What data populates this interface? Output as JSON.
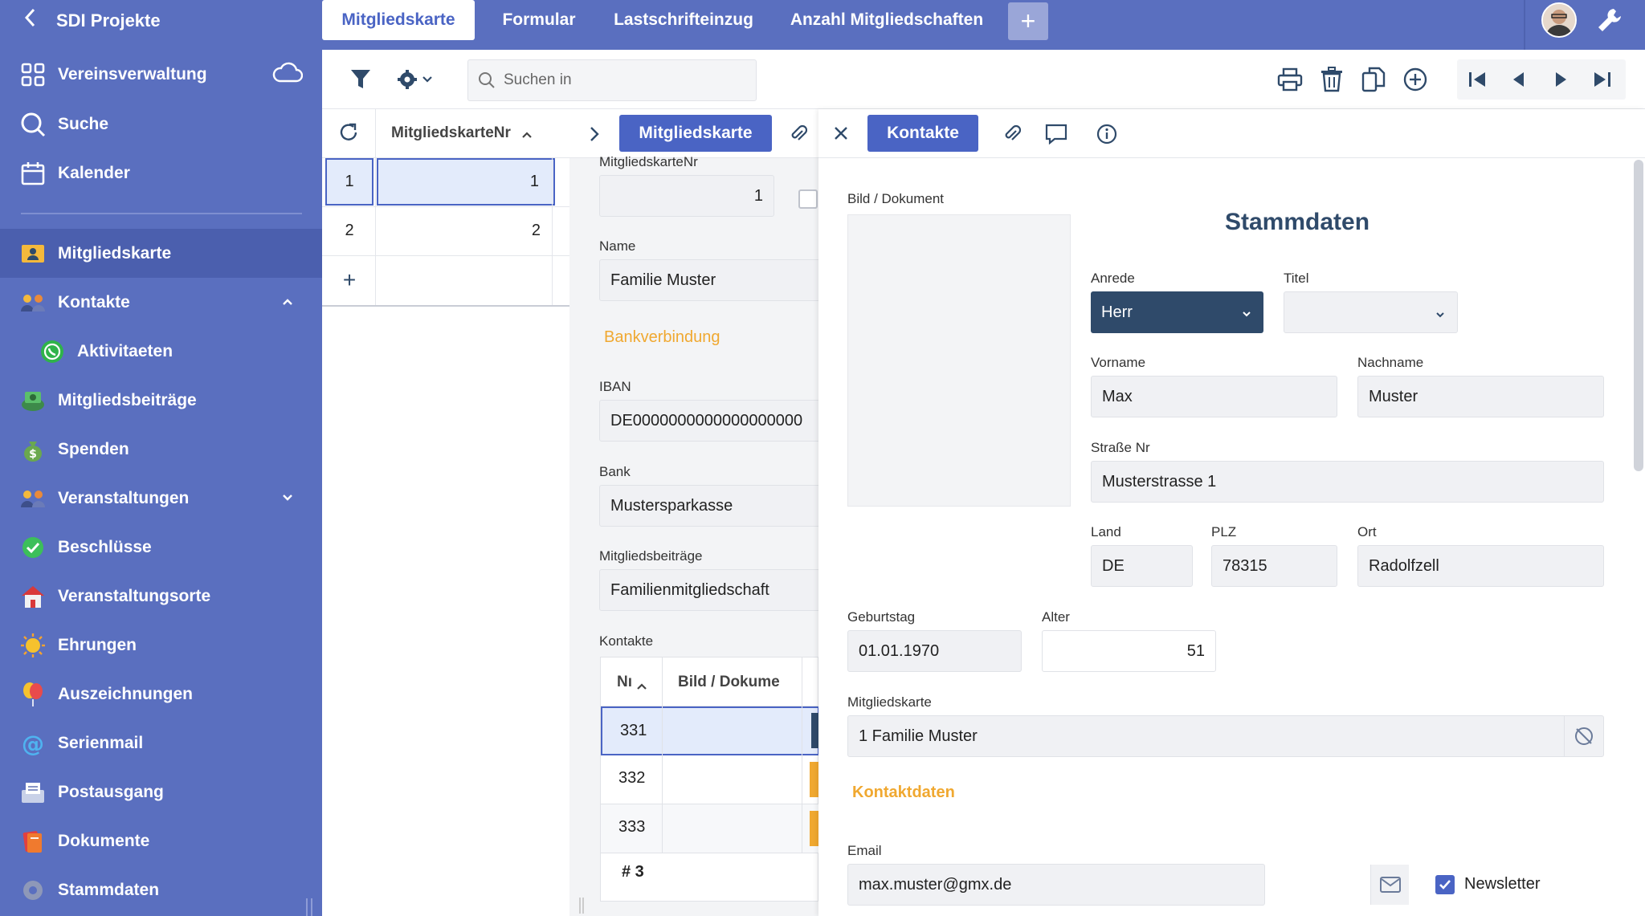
{
  "sidebar": {
    "header": "SDI Projekte",
    "items": [
      {
        "label": "Vereinsverwaltung"
      },
      {
        "label": "Suche"
      },
      {
        "label": "Kalender"
      },
      {
        "label": "Mitgliedskarte"
      },
      {
        "label": "Kontakte"
      },
      {
        "label": "Aktivitaeten"
      },
      {
        "label": "Mitgliedsbeiträge"
      },
      {
        "label": "Spenden"
      },
      {
        "label": "Veranstaltungen"
      },
      {
        "label": "Beschlüsse"
      },
      {
        "label": "Veranstaltungsorte"
      },
      {
        "label": "Ehrungen"
      },
      {
        "label": "Auszeichnungen"
      },
      {
        "label": "Serienmail"
      },
      {
        "label": "Postausgang"
      },
      {
        "label": "Dokumente"
      },
      {
        "label": "Stammdaten"
      }
    ]
  },
  "tabs": [
    {
      "label": "Mitgliedskarte"
    },
    {
      "label": "Formular"
    },
    {
      "label": "Lastschrifteinzug"
    },
    {
      "label": "Anzahl Mitgliedschaften"
    }
  ],
  "tab_add": "+",
  "toolbar": {
    "search_placeholder": "Suchen in"
  },
  "list": {
    "column": "MitgliedskarteNr",
    "rows": [
      {
        "idx": "1",
        "value": "1"
      },
      {
        "idx": "2",
        "value": "2"
      }
    ],
    "add": "+"
  },
  "middle": {
    "tab": "Mitgliedskarte",
    "nr_label": "MitgliedskarteNr",
    "nr_value": "1",
    "name_label": "Name",
    "name_value": "Familie Muster",
    "bank_section": "Bankverbindung",
    "iban_label": "IBAN",
    "iban_value": "DE0000000000000000000",
    "bank_label": "Bank",
    "bank_value": "Mustersparkasse",
    "beitrag_label": "Mitgliedsbeiträge",
    "beitrag_value": "Familienmitgliedschaft",
    "kontakte_label": "Kontakte",
    "kontakte_cols": [
      "Nı",
      "Bild / Dokume"
    ],
    "kontakte_rows": [
      "331",
      "332",
      "333"
    ],
    "kontakte_count": "# 3"
  },
  "right": {
    "tab": "Kontakte",
    "bild_label": "Bild / Dokument",
    "title": "Stammdaten",
    "anrede_label": "Anrede",
    "anrede_value": "Herr",
    "titel_label": "Titel",
    "titel_value": "",
    "vorname_label": "Vorname",
    "vorname_value": "Max",
    "nachname_label": "Nachname",
    "nachname_value": "Muster",
    "strasse_label": "Straße Nr",
    "strasse_value": "Musterstrasse 1",
    "land_label": "Land",
    "land_value": "DE",
    "plz_label": "PLZ",
    "plz_value": "78315",
    "ort_label": "Ort",
    "ort_value": "Radolfzell",
    "geburtstag_label": "Geburtstag",
    "geburtstag_value": "01.01.1970",
    "alter_label": "Alter",
    "alter_value": "51",
    "mitgliedskarte_label": "Mitgliedskarte",
    "mitgliedskarte_value": "1 Familie Muster",
    "kontaktdaten_section": "Kontaktdaten",
    "email_label": "Email",
    "email_value": "max.muster@gmx.de",
    "newsletter_label": "Newsletter",
    "newsletter_checked": true
  },
  "colors": {
    "sidebar": "#5a6fbf",
    "accent": "#4a64c4",
    "dark_select": "#2f4a6a",
    "orange": "#f0a830"
  }
}
